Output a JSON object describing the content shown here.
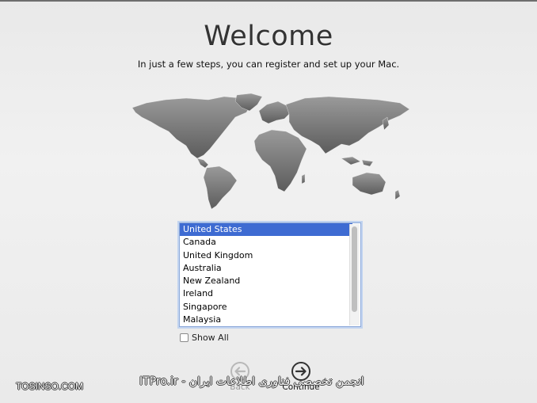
{
  "header": {
    "title": "Welcome",
    "subtitle": "In just a few steps, you can register and set up your Mac."
  },
  "country_list": {
    "selected": "United States",
    "items": [
      "United States",
      "Canada",
      "United Kingdom",
      "Australia",
      "New Zealand",
      "Ireland",
      "Singapore",
      "Malaysia"
    ]
  },
  "show_all": {
    "label": "Show All",
    "checked": false
  },
  "nav": {
    "back_label": "Back",
    "continue_label": "Continue"
  },
  "watermarks": {
    "left": "TOSINSO.COM",
    "center": "انجمن تخصصی فناوری اطلاعات ایران - ITPro.ir"
  },
  "colors": {
    "selection": "#3e6bd2",
    "list_border": "#8da9d9"
  },
  "icons": {
    "map": "world-map-icon",
    "back": "back-arrow-icon",
    "continue": "continue-arrow-icon"
  }
}
